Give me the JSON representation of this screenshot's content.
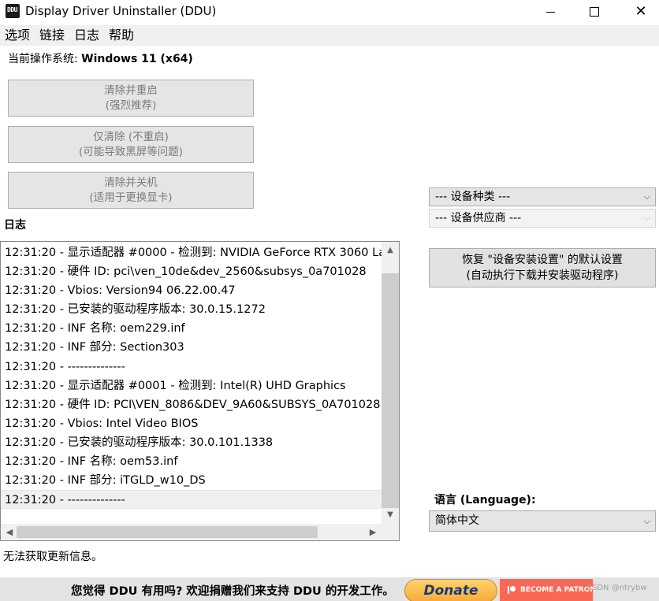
{
  "window": {
    "title": "Display Driver Uninstaller (DDU)",
    "icon_text": "DDU",
    "controls": {
      "minimize_icon": "minimize-icon",
      "maximize_icon": "maximize-icon",
      "close_icon": "close-icon"
    }
  },
  "menu": [
    "选项",
    "链接",
    "日志",
    "帮助"
  ],
  "os": {
    "label": "当前操作系统: ",
    "value": "Windows 11 (x64)"
  },
  "actions": [
    {
      "line1": "清除并重启",
      "line2": "(强烈推荐)"
    },
    {
      "line1": "仅清除 (不重启)",
      "line2": "(可能导致黑屏等问题)"
    },
    {
      "line1": "清除并关机",
      "line2": "(适用于更换显卡)"
    }
  ],
  "log": {
    "label": "日志",
    "lines": [
      "12:31:20 - 显示适配器 #0000 - 检测到: NVIDIA GeForce RTX 3060 La",
      "12:31:20 - 硬件 ID: pci\\ven_10de&dev_2560&subsys_0a701028",
      "12:31:20 - Vbios: Version94 06.22.00.47",
      "12:31:20 - 已安装的驱动程序版本: 30.0.15.1272",
      "12:31:20 - INF 名称: oem229.inf",
      "12:31:20 - INF 部分: Section303",
      "12:31:20 - --------------",
      "12:31:20 - 显示适配器 #0001 - 检测到: Intel(R) UHD Graphics",
      "12:31:20 - 硬件 ID: PCI\\VEN_8086&DEV_9A60&SUBSYS_0A701028",
      "12:31:20 - Vbios: Intel Video BIOS",
      "12:31:20 - 已安装的驱动程序版本: 30.0.101.1338",
      "12:31:20 - INF 名称: oem53.inf",
      "12:31:20 - INF 部分: iTGLD_w10_DS",
      "12:31:20 - --------------"
    ]
  },
  "device_type": {
    "value": "--- 设备种类 ---"
  },
  "device_vendor": {
    "value": "--- 设备供应商 ---"
  },
  "restore": {
    "line1": "恢复 \"设备安装设置\" 的默认设置",
    "line2": "(自动执行下载并安装驱动程序)"
  },
  "language": {
    "label": "语言 (Language):",
    "value": "简体中文"
  },
  "update_status": "无法获取更新信息。",
  "footer": {
    "text": "您觉得 DDU 有用吗? 欢迎捐赠我们来支持 DDU 的开发工作。",
    "donate_label": "Donate",
    "patreon_label": "BECOME A PATRON",
    "watermark": "CSDN @ntrybw"
  }
}
